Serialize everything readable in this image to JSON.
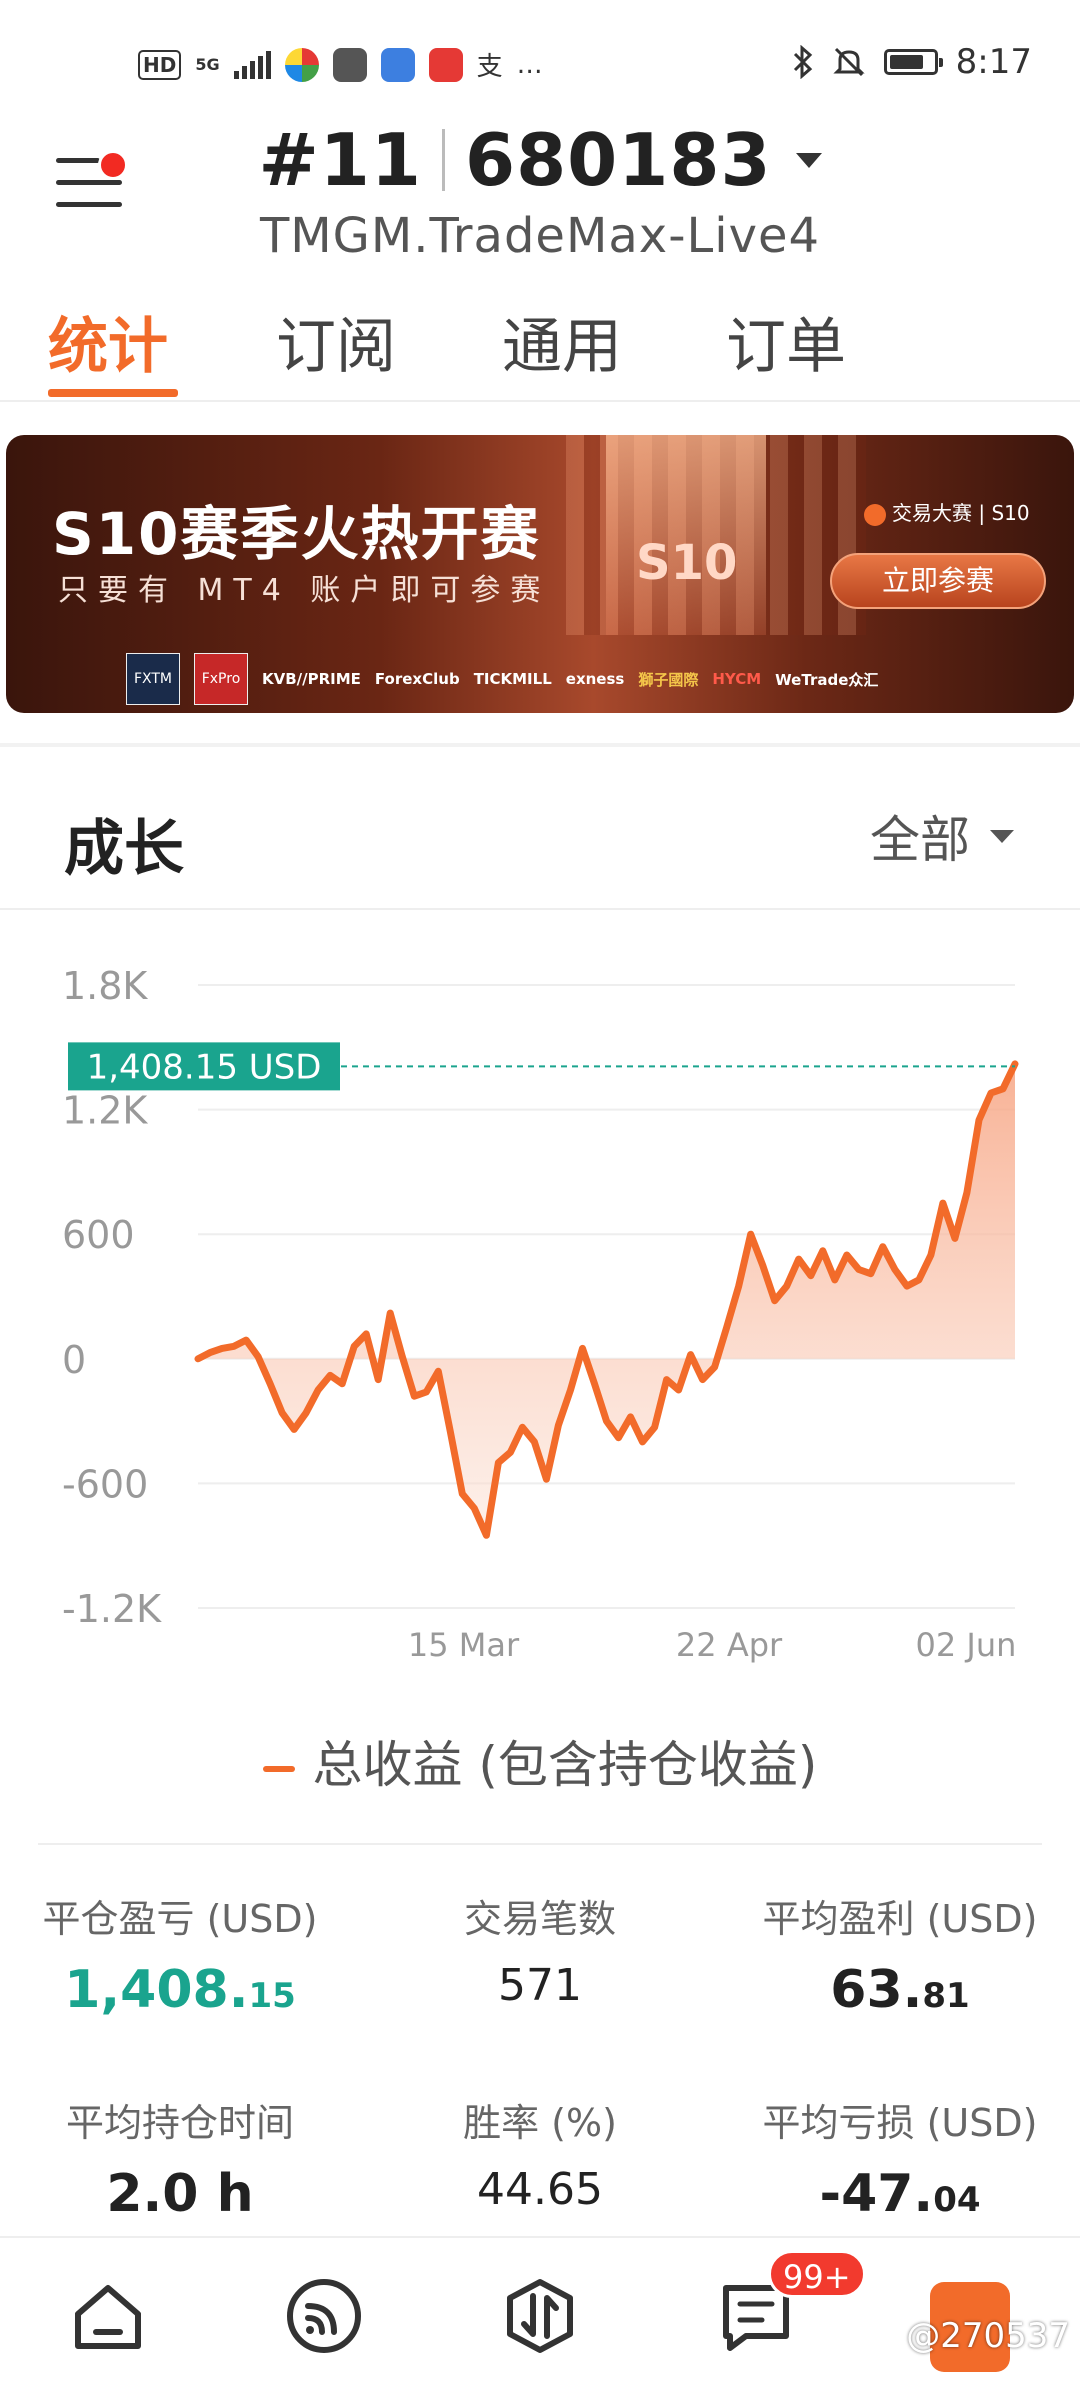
{
  "status_bar": {
    "hd": "HD",
    "network": "5G",
    "time": "8:17",
    "battery_level": 0.8,
    "more": "…",
    "pay_glyph": "支"
  },
  "header": {
    "account_prefix": "#11",
    "account_number": "680183",
    "server": "TMGM.TradeMax-Live4"
  },
  "tabs": [
    {
      "label": "统计",
      "active": true
    },
    {
      "label": "订阅",
      "active": false
    },
    {
      "label": "通用",
      "active": false
    },
    {
      "label": "订单",
      "active": false
    }
  ],
  "banner": {
    "title": "S10赛季火热开赛",
    "subtitle": "只要有 MT4 账户即可参赛",
    "brand": "交易大赛 | S10",
    "watermark_text": "S10",
    "cta": "立即参赛",
    "sponsors": [
      "FXTM",
      "FxPro",
      "KVB//PRIME",
      "ForexClub",
      "TICKMILL",
      "exness",
      "獅子國際",
      "HYCM",
      "WeTrade众汇"
    ]
  },
  "growth": {
    "title": "成长",
    "filter": "全部"
  },
  "chart_data": {
    "type": "area",
    "y_ticks": [
      "1.8K",
      "1.2K",
      "600",
      "0",
      "-600",
      "-1.2K"
    ],
    "ylim": [
      -1200,
      1800
    ],
    "x_ticks": [
      "15 Mar",
      "22 Apr",
      "02 Jun"
    ],
    "current_label": "1,408.15 USD",
    "current_value": 1408.15,
    "series": [
      {
        "name": "总收益 (包含持仓收益)",
        "color": "#f26b2a",
        "values": [
          0,
          30,
          50,
          60,
          90,
          10,
          -120,
          -260,
          -340,
          -260,
          -150,
          -80,
          -120,
          60,
          120,
          -100,
          220,
          10,
          -180,
          -160,
          -60,
          -350,
          -650,
          -720,
          -850,
          -500,
          -450,
          -330,
          -400,
          -580,
          -320,
          -150,
          50,
          -120,
          -300,
          -380,
          -280,
          -400,
          -330,
          -100,
          -150,
          20,
          -100,
          -40,
          150,
          350,
          600,
          450,
          280,
          350,
          480,
          400,
          520,
          380,
          500,
          430,
          410,
          540,
          430,
          350,
          380,
          500,
          750,
          580,
          800,
          1150,
          1280,
          1300,
          1420
        ]
      }
    ],
    "legend": "总收益 (包含持仓收益)"
  },
  "stats": [
    {
      "label": "平仓盈亏 (USD)",
      "value_main": "1,408.",
      "value_small": "15",
      "style": "green"
    },
    {
      "label": "交易笔数",
      "value_main": "571",
      "value_small": "",
      "style": "plain"
    },
    {
      "label": "平均盈利 (USD)",
      "value_main": "63.",
      "value_small": "81",
      "style": "bold"
    },
    {
      "label": "平均持仓时间",
      "value_main": "2.0 h",
      "value_small": "",
      "style": "bold"
    },
    {
      "label": "胜率 (%)",
      "value_main": "44.65",
      "value_small": "",
      "style": "plain"
    },
    {
      "label": "平均亏损 (USD)",
      "value_main": "-47.",
      "value_small": "04",
      "style": "bold"
    }
  ],
  "bottom_nav": {
    "badge": "99+",
    "watermark": "@270537"
  }
}
